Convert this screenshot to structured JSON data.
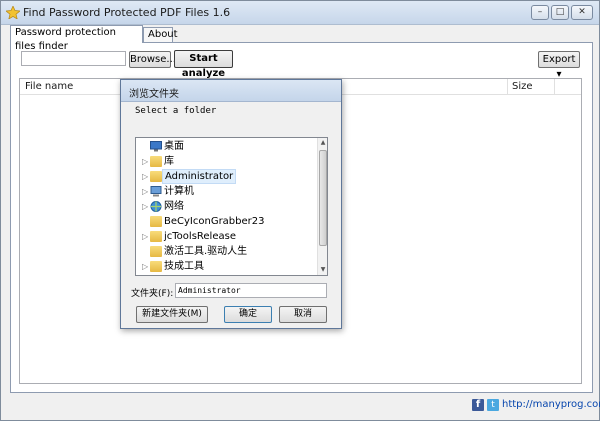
{
  "window": {
    "title": "Find Password Protected PDF Files 1.6",
    "controls": {
      "minimize": "–",
      "maximize": "□",
      "close": "✕"
    }
  },
  "tabs": [
    {
      "label": "Password protection files finder",
      "active": true
    },
    {
      "label": "About",
      "active": false
    }
  ],
  "toolbar": {
    "path_value": "",
    "browse_label": "Browse...",
    "analyze_label": "Start analyze",
    "export_label": "Export ▾"
  },
  "list": {
    "columns": [
      "File name",
      "Size"
    ],
    "rows": []
  },
  "footer": {
    "facebook_glyph": "f",
    "twitter_glyph": "t",
    "link_text": "http://manyprog.com"
  },
  "dialog": {
    "title": "浏览文件夹",
    "message": "Select a folder",
    "tree": [
      {
        "label": "桌面",
        "icon": "desktop-icon",
        "expandable": false
      },
      {
        "label": "库",
        "icon": "library-icon",
        "expandable": true
      },
      {
        "label": "Administrator",
        "icon": "user-folder-icon",
        "expandable": true,
        "selected": true
      },
      {
        "label": "计算机",
        "icon": "computer-icon",
        "expandable": true
      },
      {
        "label": "网络",
        "icon": "network-icon",
        "expandable": true
      },
      {
        "label": "BeCyIconGrabber23",
        "icon": "folder-icon",
        "expandable": false
      },
      {
        "label": "jcToolsRelease",
        "icon": "folder-icon",
        "expandable": true
      },
      {
        "label": "激活工具.驱动人生",
        "icon": "folder-icon",
        "expandable": false
      },
      {
        "label": "技成工具",
        "icon": "folder-icon",
        "expandable": true
      }
    ],
    "folder_label": "文件夹(F):",
    "folder_value": "Administrator",
    "new_folder_label": "新建文件夹(M)",
    "ok_label": "确定",
    "cancel_label": "取消"
  },
  "colors": {
    "accent": "#0645ad",
    "titlebar": "#c6d6ea",
    "facebook": "#3b5998",
    "twitter": "#4aa8e0"
  }
}
